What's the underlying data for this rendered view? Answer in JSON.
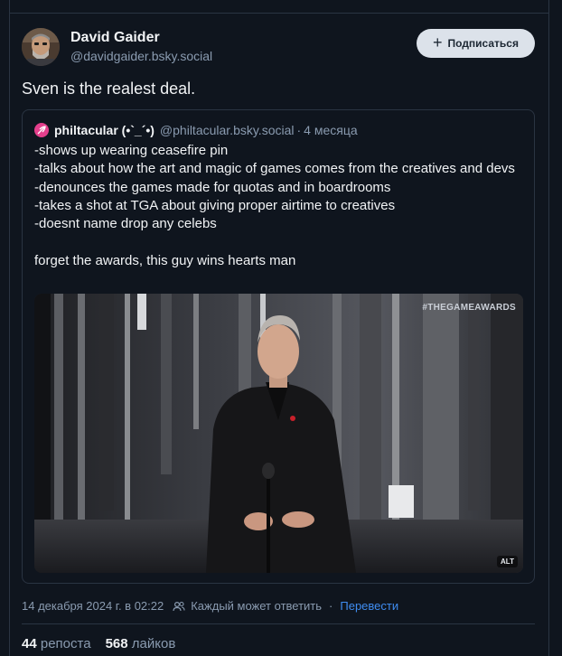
{
  "post": {
    "author": {
      "name": "David Gaider",
      "handle": "@davidgaider.bsky.social"
    },
    "follow_label": "Подписаться",
    "text": "Sven is the realest deal.",
    "quote": {
      "author_name": "philtacular (•`_´•)",
      "author_handle": "@philtacular.bsky.social",
      "separator": "·",
      "time_ago": "4 месяца",
      "lines": [
        "-shows up wearing ceasefire pin",
        "-talks about how the art and magic of games comes from the creatives and devs",
        "-denounces the games made for quotas and in boardrooms",
        "-takes a shot at TGA about giving proper airtime to creatives",
        "-doesnt name drop any celebs",
        "",
        "forget the awards, this guy wins hearts man"
      ],
      "media": {
        "tag": "#THEGAMEAWARDS",
        "alt_badge": "ALT"
      }
    },
    "meta": {
      "timestamp": "14 декабря 2024 г. в 02:22",
      "reply_setting": "Каждый может ответить",
      "dot": "·",
      "translate_label": "Перевести"
    },
    "stats": {
      "reposts_count": "44",
      "reposts_label": "репоста",
      "likes_count": "568",
      "likes_label": "лайков"
    }
  },
  "colors": {
    "background": "#0f151e",
    "border": "#2a3442",
    "text_primary": "#f1f3f5",
    "text_secondary": "#8a9bb0",
    "link": "#3f8cf0",
    "button_bg": "#dce2ea",
    "quote_avatar": "#e43f8c"
  }
}
